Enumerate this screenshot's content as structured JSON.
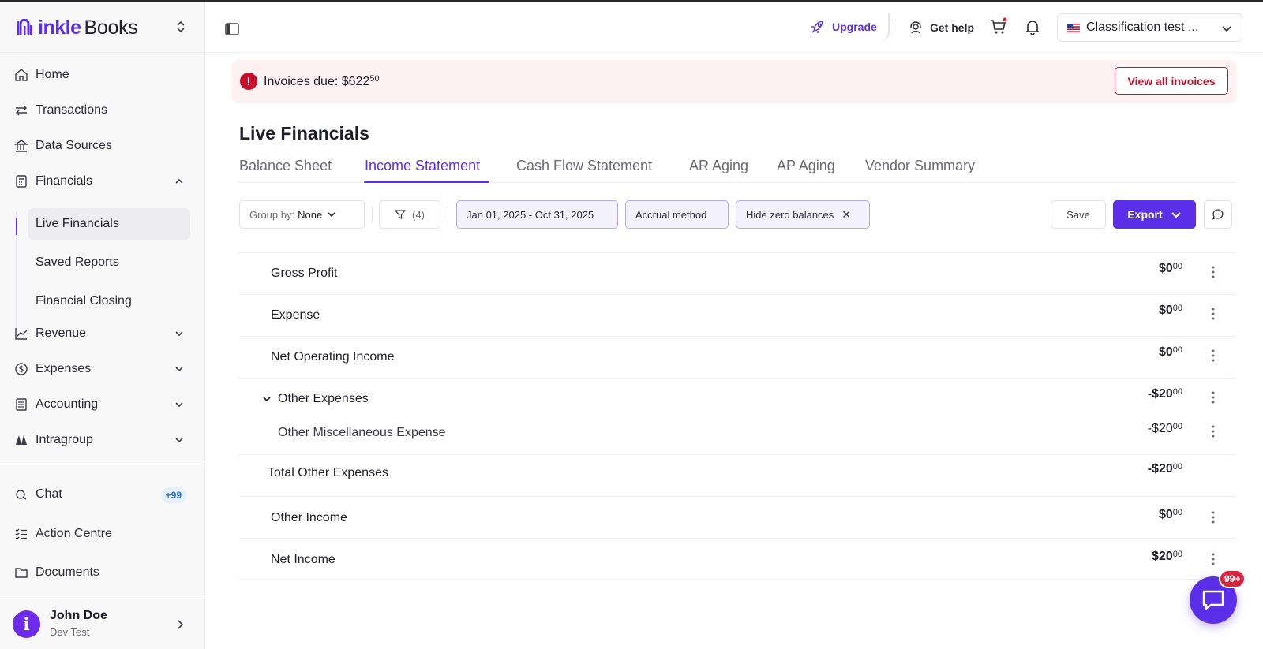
{
  "brand": {
    "name_bold": "inkle",
    "name_light": "Books"
  },
  "sidebar": {
    "nav": [
      {
        "label": "Home",
        "icon": "home-icon"
      },
      {
        "label": "Transactions",
        "icon": "arrows-icon"
      },
      {
        "label": "Data Sources",
        "icon": "bank-icon"
      },
      {
        "label": "Financials",
        "icon": "calculator-icon"
      }
    ],
    "financials_sub": [
      {
        "label": "Live Financials",
        "active": true
      },
      {
        "label": "Saved Reports"
      },
      {
        "label": "Financial Closing"
      }
    ],
    "nav2": [
      {
        "label": "Revenue",
        "icon": "chart-icon"
      },
      {
        "label": "Expenses",
        "icon": "dollar-circle-icon"
      },
      {
        "label": "Accounting",
        "icon": "ledger-icon"
      },
      {
        "label": "Intragroup",
        "icon": "intragroup-icon"
      }
    ],
    "bottom": [
      {
        "label": "Chat",
        "icon": "chat-icon",
        "badge": "+99"
      },
      {
        "label": "Action Centre",
        "icon": "checklist-icon"
      },
      {
        "label": "Documents",
        "icon": "folder-icon"
      }
    ],
    "user": {
      "initial": "i",
      "name": "John Doe",
      "subtitle": "Dev Test"
    }
  },
  "header": {
    "upgrade": "Upgrade",
    "get_help": "Get help",
    "entity": "Classification test ..."
  },
  "alert": {
    "text": "Invoices due: $622",
    "cents": "50",
    "button": "View all invoices"
  },
  "main": {
    "title": "Live Financials",
    "tabs": [
      "Balance Sheet",
      "Income Statement",
      "Cash Flow Statement",
      "AR Aging",
      "AP Aging",
      "Vendor Summary"
    ],
    "active_tab": "Income Statement"
  },
  "toolbar": {
    "group_by_label": "Group by:",
    "group_by_value": "None",
    "filter_count": "(4)",
    "date_range": "Jan 01, 2025 - Oct 31, 2025",
    "method": "Accrual method",
    "hide_zero": "Hide zero balances",
    "save": "Save",
    "export": "Export"
  },
  "rows": [
    {
      "label": "Gross Profit",
      "amount": "$0",
      "cents": "00"
    },
    {
      "label": "Expense",
      "amount": "$0",
      "cents": "00"
    },
    {
      "label": "Net Operating Income",
      "amount": "$0",
      "cents": "00"
    },
    {
      "label": "Other Expenses",
      "amount": "-$20",
      "cents": "00"
    },
    {
      "label": "Other Miscellaneous Expense",
      "amount": "-$20",
      "cents": "00"
    },
    {
      "label": "Total Other Expenses",
      "amount": "-$20",
      "cents": "00"
    },
    {
      "label": "Other Income",
      "amount": "$0",
      "cents": "00"
    },
    {
      "label": "Net Income",
      "amount": "$20",
      "cents": "00"
    }
  ],
  "fab": {
    "badge": "99+"
  },
  "colors": {
    "accent": "#5b2ee8",
    "danger": "#c8102e",
    "alert_bg": "#fdf1f2"
  }
}
